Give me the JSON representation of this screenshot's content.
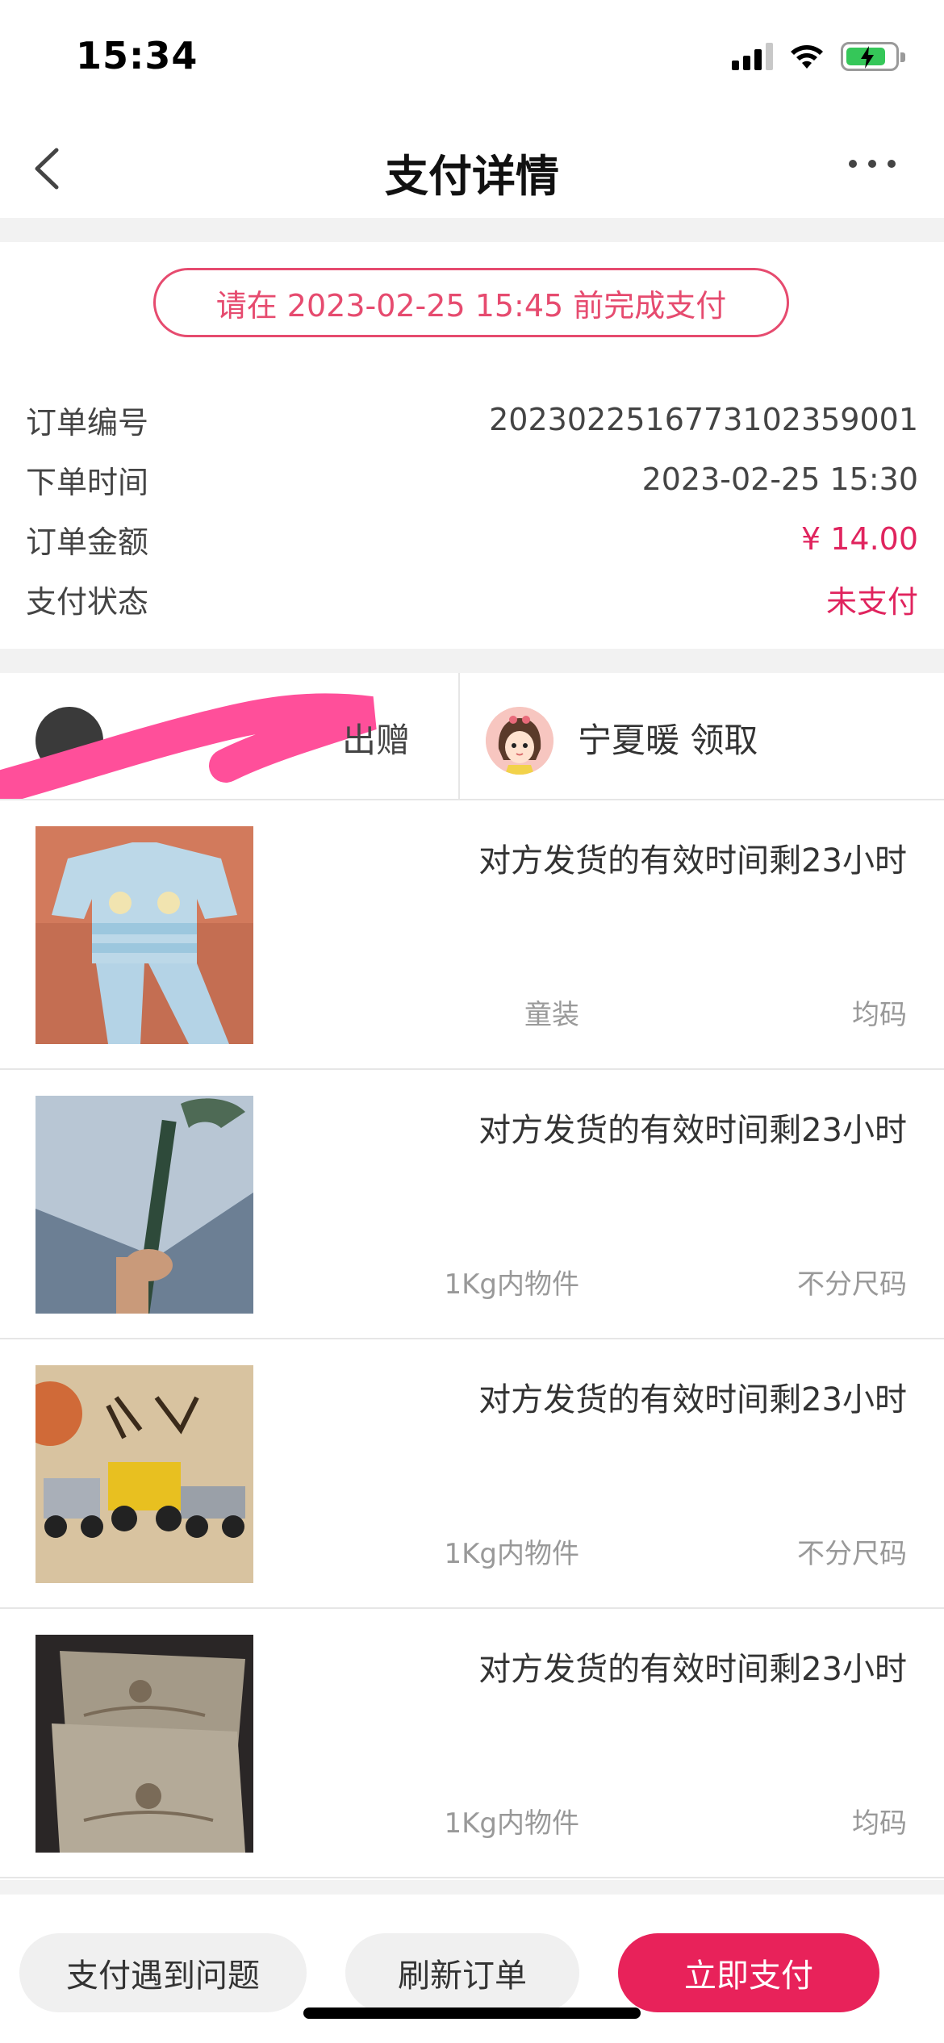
{
  "status_bar": {
    "time": "15:34",
    "icons": [
      "cellular-signal-icon",
      "wifi-icon",
      "battery-charging-icon"
    ],
    "battery_color": "#35c759"
  },
  "nav": {
    "title": "支付详情",
    "back_icon": "chevron-left-icon",
    "more_icon": "more-dots-icon"
  },
  "deadline": {
    "text": "请在 2023-02-25 15:45 前完成支付",
    "color": "#e64b6f"
  },
  "order": {
    "number_label": "订单编号",
    "number_value": "2023022516773102359001",
    "time_label": "下单时间",
    "time_value": "2023-02-25 15:30",
    "amount_label": "订单金额",
    "amount_value": "¥ 14.00",
    "status_label": "支付状态",
    "status_value": "未支付",
    "accent_color": "#e0245e"
  },
  "parties": {
    "giver_suffix": "出赠",
    "receiver": "宁夏暖 领取"
  },
  "items": [
    {
      "title": "对方发货的有效时间剩23小时",
      "category": "童装",
      "size": "均码"
    },
    {
      "title": "对方发货的有效时间剩23小时",
      "category": "1Kg内物件",
      "size": "不分尺码"
    },
    {
      "title": "对方发货的有效时间剩23小时",
      "category": "1Kg内物件",
      "size": "不分尺码"
    },
    {
      "title": "对方发货的有效时间剩23小时",
      "category": "1Kg内物件",
      "size": "均码"
    }
  ],
  "actions": {
    "problem": "支付遇到问题",
    "refresh": "刷新订单",
    "pay": "立即支付",
    "pay_color": "#e8225a"
  }
}
